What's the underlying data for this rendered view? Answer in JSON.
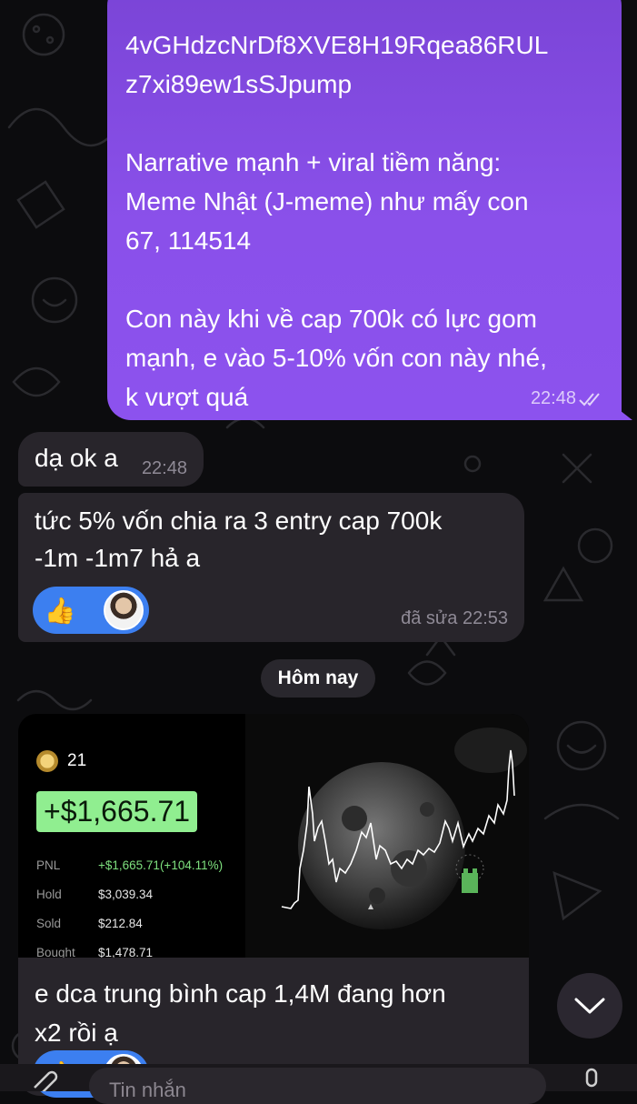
{
  "messages": {
    "outgoing": {
      "text": "4vGHdzcNrDf8XVE8H19Rqea86RUL\nz7xi89ew1sSJpump\n\nNarrative mạnh + viral tiềm năng:\nMeme Nhật (J-meme) như mấy con\n67, 114514\n\nCon này khi về cap 700k có lực gom\nmạnh, e vào 5-10% vốn con này nhé,\nk vượt quá",
      "time": "22:48",
      "status_icon": "double-check-icon"
    },
    "reply1": {
      "text": "dạ ok a",
      "time": "22:48"
    },
    "reply2": {
      "text": "tức 5% vốn chia ra 3 entry cap 700k\n-1m -1m7 hả a",
      "reaction_emoji": "👍",
      "meta": "đã sửa 22:53"
    },
    "reply3": {
      "text": "e dca trung bình cap 1,4M đang hơn\nx2 rồi ạ",
      "reaction_emoji": "👍"
    }
  },
  "date_separator": "Hôm nay",
  "pnl_card": {
    "rank": "21",
    "gain": "+$1,665.71",
    "stats": [
      {
        "label": "PNL",
        "value": "+$1,665.71(+104.11%)"
      },
      {
        "label": "Hold",
        "value": "$3,039.34"
      },
      {
        "label": "Sold",
        "value": "$212.84"
      },
      {
        "label": "Bought",
        "value": "$1,478.71"
      }
    ]
  },
  "input": {
    "placeholder": "Tin nhắn"
  },
  "colors": {
    "outgoing_bubble": "#8c52ee",
    "incoming_bubble": "#28252b",
    "reaction": "#3c7ff0",
    "gain_highlight": "#90ee90"
  }
}
